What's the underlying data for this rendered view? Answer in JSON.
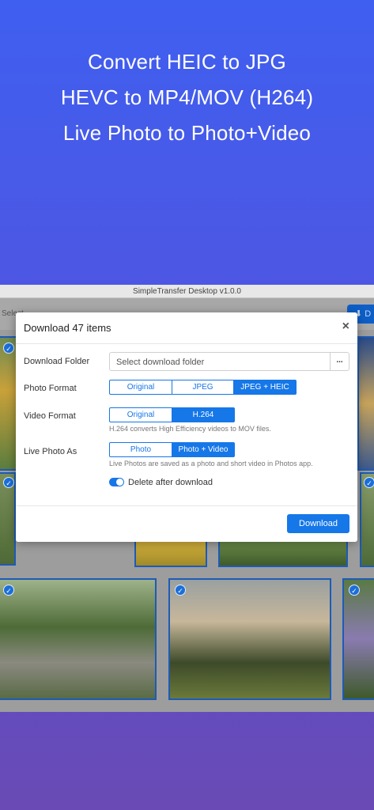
{
  "headline": {
    "line1": "Convert HEIC to JPG",
    "line2": "HEVC to MP4/MOV (H264)",
    "line3": "Live Photo to Photo+Video"
  },
  "window": {
    "title": "SimpleTransfer Desktop v1.0.0",
    "toolbar": {
      "select_label": "Select",
      "download_label": "D"
    }
  },
  "dialog": {
    "title": "Download 47 items",
    "close_glyph": "×",
    "folder": {
      "label": "Download Folder",
      "placeholder": "Select download folder",
      "browse_label": "..."
    },
    "photo_format": {
      "label": "Photo Format",
      "options": [
        "Original",
        "JPEG",
        "JPEG + HEIC"
      ],
      "selected": "JPEG + HEIC"
    },
    "video_format": {
      "label": "Video Format",
      "options": [
        "Original",
        "H.264"
      ],
      "selected": "H.264",
      "hint": "H.264 converts High Efficiency videos to MOV files."
    },
    "live_photo": {
      "label": "Live Photo As",
      "options": [
        "Photo",
        "Photo + Video"
      ],
      "selected": "Photo + Video",
      "hint": "Live Photos are saved as a photo and short video in Photos app."
    },
    "delete_after": {
      "label": "Delete after download",
      "checked": true
    },
    "download_button": "Download"
  },
  "colors": {
    "accent": "#1677e8",
    "selection_border": "#1d5bb7"
  }
}
